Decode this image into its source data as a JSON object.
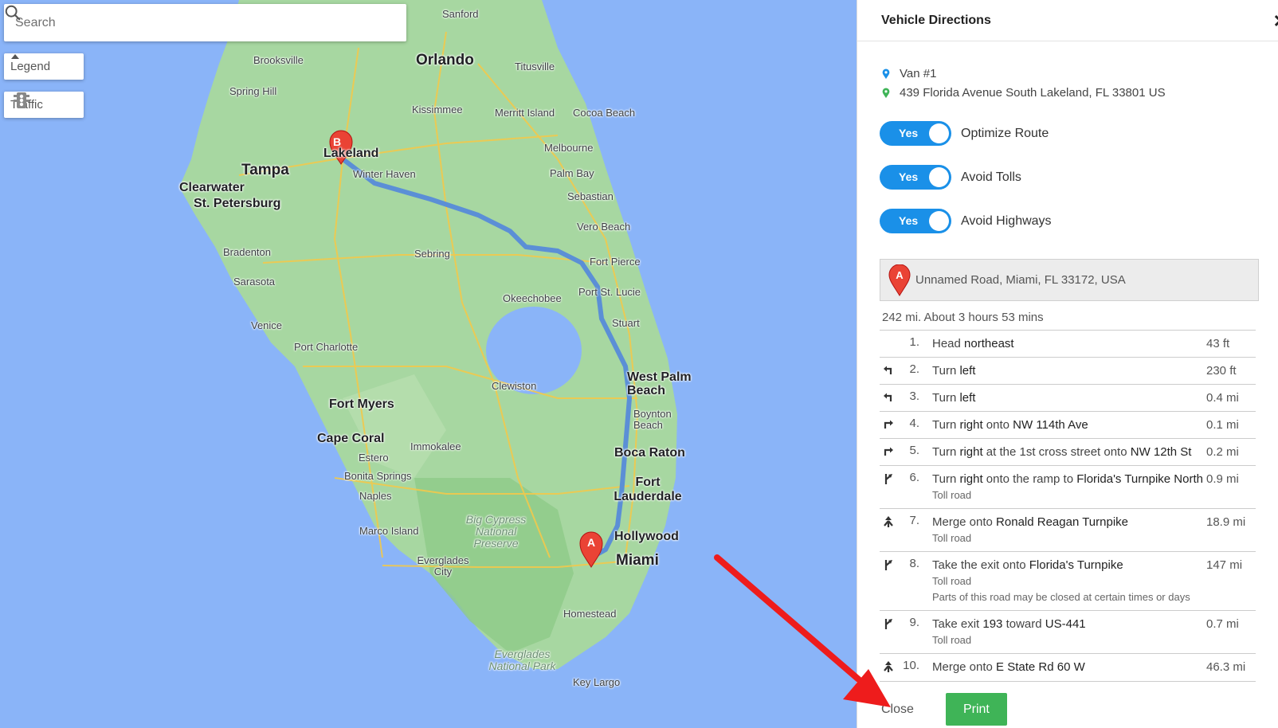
{
  "map": {
    "search_placeholder": "Search",
    "legend_label": "Legend",
    "traffic_label": "Traffic",
    "route_color": "#5b8fd6",
    "marker_color": "#ea4335",
    "marker_a_label": "A",
    "marker_b_label": "B",
    "cities": {
      "sanford": "Sanford",
      "orlando": "Orlando",
      "brooksville": "Brooksville",
      "spring_hill": "Spring Hill",
      "titusville": "Titusville",
      "kissimmee": "Kissimmee",
      "merritt_island": "Merritt Island",
      "cocoa_beach": "Cocoa Beach",
      "lakeland": "Lakeland",
      "tampa": "Tampa",
      "clearwater": "Clearwater",
      "st_petersburg": "St. Petersburg",
      "winter_haven": "Winter Haven",
      "melbourne": "Melbourne",
      "palm_bay": "Palm Bay",
      "sebastian": "Sebastian",
      "vero_beach": "Vero Beach",
      "fort_pierce": "Fort Pierce",
      "bradenton": "Bradenton",
      "sarasota": "Sarasota",
      "sebring": "Sebring",
      "port_st_lucie": "Port St. Lucie",
      "okeechobee": "Okeechobee",
      "stuart": "Stuart",
      "venice": "Venice",
      "port_charlotte": "Port Charlotte",
      "west_palm_beach": "West Palm Beach",
      "clewiston": "Clewiston",
      "fort_myers": "Fort Myers",
      "boynton_beach": "Boynton Beach",
      "cape_coral": "Cape Coral",
      "immokalee": "Immokalee",
      "estero": "Estero",
      "boca_raton": "Boca Raton",
      "bonita_springs": "Bonita Springs",
      "naples": "Naples",
      "fort_lauderdale": "Fort Lauderdale",
      "big_cypress": "Big Cypress National Preserve",
      "marco_island": "Marco Island",
      "hollywood": "Hollywood",
      "miami": "Miami",
      "everglades_city": "Everglades City",
      "homestead": "Homestead",
      "everglades_np": "Everglades National Park",
      "key_largo": "Key Largo"
    }
  },
  "panel": {
    "title": "Vehicle Directions",
    "close_glyph": "✕",
    "vehicle_name": "Van #1",
    "destination_address": "439 Florida Avenue South Lakeland, FL 33801 US",
    "toggles": [
      {
        "state": "Yes",
        "label": "Optimize Route"
      },
      {
        "state": "Yes",
        "label": "Avoid Tolls"
      },
      {
        "state": "Yes",
        "label": "Avoid Highways"
      }
    ],
    "start_marker": "A",
    "start_address": "Unnamed Road, Miami, FL 33172, USA",
    "summary": "242 mi. About 3 hours 53 mins",
    "steps": [
      {
        "num": "1.",
        "icon": "none",
        "pre": "Head ",
        "bold": "northeast",
        "mid": "",
        "bold2": "",
        "dist": "43 ft",
        "note": "",
        "note2": ""
      },
      {
        "num": "2.",
        "icon": "turn-left-icon",
        "pre": "Turn ",
        "bold": "left",
        "mid": "",
        "bold2": "",
        "dist": "230 ft",
        "note": "",
        "note2": ""
      },
      {
        "num": "3.",
        "icon": "turn-left-icon",
        "pre": "Turn ",
        "bold": "left",
        "mid": "",
        "bold2": "",
        "dist": "0.4 mi",
        "note": "",
        "note2": ""
      },
      {
        "num": "4.",
        "icon": "turn-right-icon",
        "pre": "Turn ",
        "bold": "right",
        "mid": " onto ",
        "bold2": "NW 114th Ave",
        "dist": "0.1 mi",
        "note": "",
        "note2": ""
      },
      {
        "num": "5.",
        "icon": "turn-right-icon",
        "pre": "Turn ",
        "bold": "right",
        "mid": " at the 1st cross street onto ",
        "bold2": "NW 12th St",
        "dist": "0.2 mi",
        "note": "",
        "note2": ""
      },
      {
        "num": "6.",
        "icon": "ramp-right-icon",
        "pre": "Turn ",
        "bold": "right",
        "mid": " onto the ramp to ",
        "bold2": "Florida's Turnpike North",
        "dist": "0.9 mi",
        "note": "Toll road",
        "note2": ""
      },
      {
        "num": "7.",
        "icon": "merge-icon",
        "pre": "Merge onto ",
        "bold": "Ronald Reagan Turnpike",
        "mid": "",
        "bold2": "",
        "dist": "18.9 mi",
        "note": "Toll road",
        "note2": ""
      },
      {
        "num": "8.",
        "icon": "ramp-right-icon",
        "pre": "Take the exit onto ",
        "bold": "Florida's Turnpike",
        "mid": "",
        "bold2": "",
        "dist": "147 mi",
        "note": "Toll road",
        "note2": "Parts of this road may be closed at certain times or days"
      },
      {
        "num": "9.",
        "icon": "ramp-right-icon",
        "pre": "Take exit ",
        "bold": "193",
        "mid": " toward ",
        "bold2": "US-441",
        "dist": "0.7 mi",
        "note": "Toll road",
        "note2": ""
      },
      {
        "num": "10.",
        "icon": "merge-icon",
        "pre": "Merge onto ",
        "bold": "E State Rd 60 W",
        "mid": "",
        "bold2": "",
        "dist": "46.3 mi",
        "note": "",
        "note2": ""
      }
    ],
    "close_button": "Close",
    "print_button": "Print",
    "toggle_color": "#1a90e8",
    "print_color": "#3fb457"
  }
}
